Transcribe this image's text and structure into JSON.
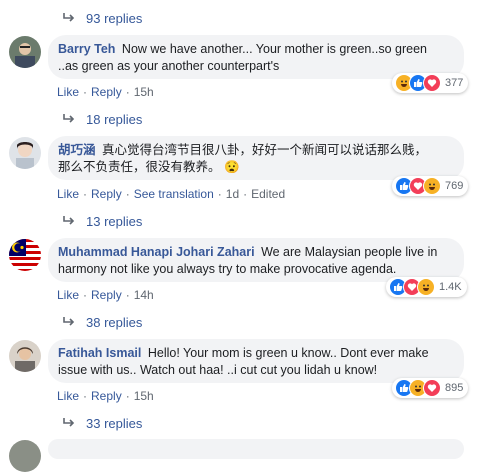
{
  "threads": [
    {
      "replies_label": "93 replies"
    },
    {
      "author": "Barry Teh",
      "text_line1": "Now we have another... Your mother is green..so green",
      "text_line2": "..as green as your another counterpart's",
      "reaction_count": "377",
      "time": "15h",
      "replies_label": "18 replies"
    },
    {
      "author": "胡巧涵",
      "text_line1": "真心觉得台湾节目很八卦，好好一个新闻可以说话那么贱，",
      "text_line2": "那么不负责任，很没有教养。",
      "emoji": "😧",
      "reaction_count": "769",
      "translate": "See translation",
      "time": "1d",
      "edited": "Edited",
      "replies_label": "13 replies"
    },
    {
      "author": "Muhammad Hanapi Johari Zahari",
      "text_line1": "We are Malaysian people live in",
      "text_line2": "harmony not like you always try to make provocative agenda.",
      "reaction_count": "1.4K",
      "time": "14h",
      "replies_label": "38 replies"
    },
    {
      "author": "Fatihah Ismail",
      "text_line1": "Hello! Your mom is green u know.. Dont ever make",
      "text_line2": "issue with us.. Watch out haa! ..i cut cut you lidah u know!",
      "reaction_count": "895",
      "time": "15h",
      "replies_label": "33 replies"
    }
  ],
  "actions": {
    "like": "Like",
    "reply": "Reply",
    "separator": "·"
  }
}
